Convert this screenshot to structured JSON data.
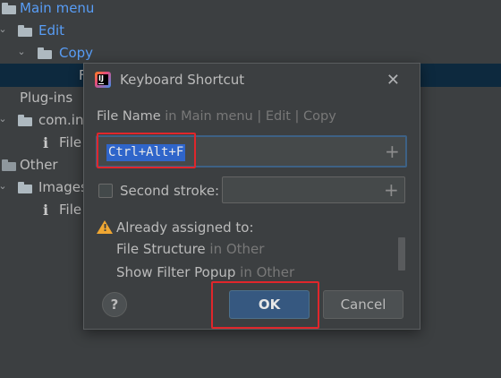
{
  "tree": {
    "items": [
      {
        "label": "Main menu"
      },
      {
        "label": "Edit"
      },
      {
        "label": "Copy"
      },
      {
        "label": "F"
      },
      {
        "label": "Plug-ins"
      },
      {
        "label": "com.in"
      },
      {
        "label": "File"
      },
      {
        "label": "Other"
      },
      {
        "label": "Images"
      },
      {
        "label": "File"
      }
    ],
    "chevron_down": "⌄",
    "chevron_right": "›",
    "info_glyph": "i"
  },
  "dialog": {
    "title": "Keyboard Shortcut",
    "close_glyph": "✕",
    "action_name": "File Name",
    "path_prefix": " in ",
    "path": "Main menu | Edit | Copy",
    "first_stroke_value": "Ctrl+Alt+F",
    "plus_glyph": "+",
    "second_stroke_label": "Second stroke:",
    "already_assigned_label": "Already assigned to:",
    "assigned": [
      {
        "name": "File Structure",
        "context": " in Other"
      },
      {
        "name": "Show Filter Popup",
        "context": " in Other"
      }
    ],
    "help_label": "?",
    "ok_label": "OK",
    "cancel_label": "Cancel"
  },
  "colors": {
    "background": "#3c3f41",
    "selection": "#0d293e",
    "link_blue": "#589df6",
    "highlight_red": "#e0262b",
    "primary_button": "#365880"
  }
}
